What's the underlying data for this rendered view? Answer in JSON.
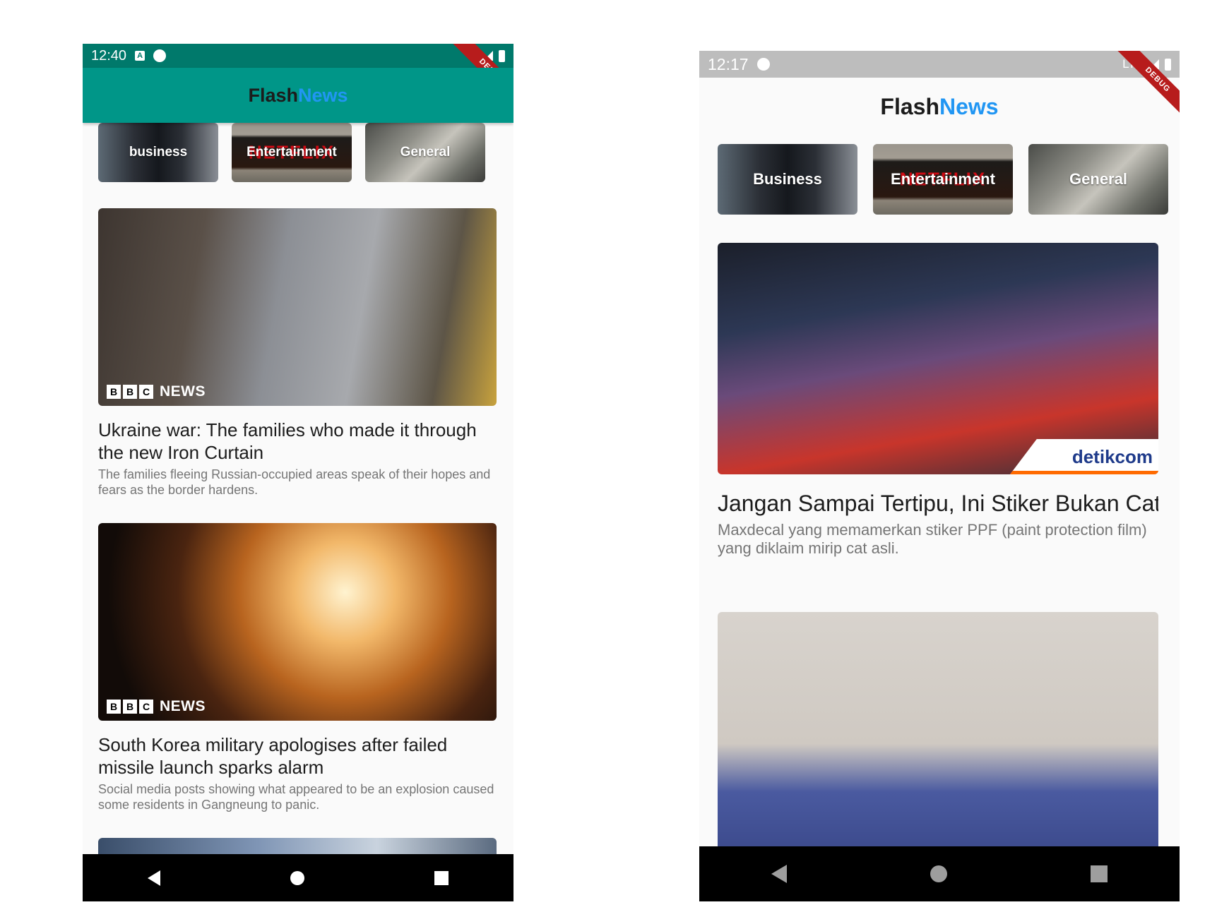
{
  "left_phone": {
    "status": {
      "time": "12:40",
      "a_icon": "A"
    },
    "debug_banner": "DEBUG",
    "appbar": {
      "title_part1": "Flash",
      "title_part2": "News",
      "title_part2_color": "#2196f3",
      "bar_color": "#009688"
    },
    "categories": [
      {
        "label": "business",
        "image": "businessman-photo"
      },
      {
        "label": "Entertainment",
        "image": "netflix-tv-photo"
      },
      {
        "label": "General",
        "image": "newspaper-reader-photo"
      }
    ],
    "articles": [
      {
        "title": "Ukraine war: The families who made it through the new Iron Curtain",
        "description": "The families fleeing Russian-occupied areas speak of their hopes and fears as the border hardens.",
        "source_badge": {
          "blocks": [
            "B",
            "B",
            "C"
          ],
          "word": "NEWS"
        }
      },
      {
        "title": "South Korea military apologises after failed missile launch sparks alarm",
        "description": "Social media posts showing what appeared to be an explosion caused some residents in Gangneung to panic.",
        "source_badge": {
          "blocks": [
            "B",
            "B",
            "C"
          ],
          "word": "NEWS"
        }
      }
    ]
  },
  "right_phone": {
    "status": {
      "time": "12:17",
      "network": "LTE"
    },
    "debug_banner": "DEBUG",
    "appbar": {
      "title_part1": "Flash",
      "title_part2": "News"
    },
    "categories": [
      {
        "label": "Business",
        "image": "businessman-photo"
      },
      {
        "label": "Entertainment",
        "image": "netflix-tv-photo"
      },
      {
        "label": "General",
        "image": "newspaper-reader-photo"
      }
    ],
    "netflix_text": "NETFLIX",
    "articles": [
      {
        "title": "Jangan Sampai Tertipu, Ini Stiker Bukan Cat Mobil yang Buat Kinclong Bodi Mobil -",
        "description": "Maxdecal yang memamerkan stiker PPF (paint protection film) yang diklaim mirip cat asli.",
        "source_logo": "detikcom"
      },
      {
        "title": "",
        "description": "",
        "image": "bank-indonesia-governor-photo"
      }
    ]
  }
}
